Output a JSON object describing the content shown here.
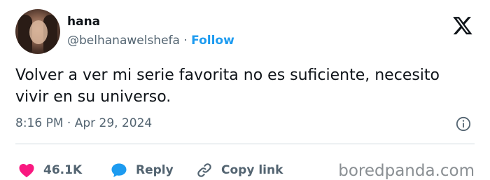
{
  "user": {
    "name": "hana",
    "handle": "@belhanawelshefa",
    "separator": "·",
    "follow_label": "Follow"
  },
  "tweet": {
    "text": "Volver a ver mi serie favorita no es suficiente, necesito vivir en su universo.",
    "time": "8:16 PM",
    "date_separator": "·",
    "date": "Apr 29, 2024"
  },
  "actions": {
    "like_count": "46.1K",
    "reply_label": "Reply",
    "copy_link_label": "Copy link"
  },
  "watermark": "boredpanda.com",
  "icons": {
    "platform": "x-logo-icon",
    "info": "info-icon",
    "like": "heart-icon",
    "reply": "speech-bubble-icon",
    "copy": "link-icon"
  },
  "colors": {
    "follow": "#1d9bf0",
    "like": "#f91880",
    "reply": "#1d9bf0",
    "secondary_text": "#536471"
  }
}
